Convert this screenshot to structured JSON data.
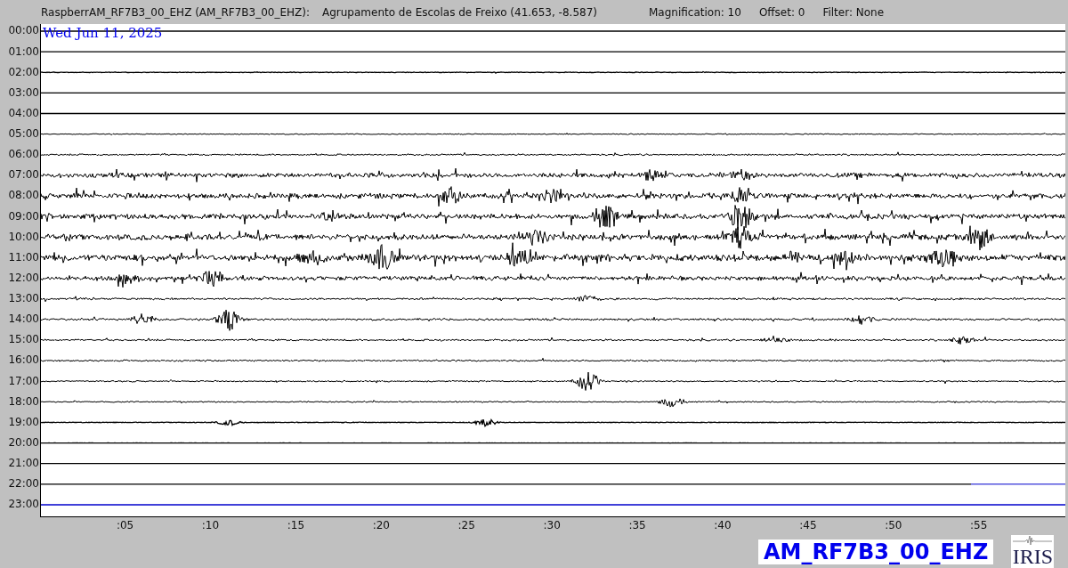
{
  "header": {
    "station": "RaspberrAM_RF7B3_00_EHZ (AM_RF7B3_00_EHZ):",
    "location": "Agrupamento de Escolas de Freixo (41.653, -8.587)",
    "magnification": "Magnification: 10",
    "offset": "Offset: 0",
    "filter": "Filter: None"
  },
  "plot": {
    "date": "Wed Jun 11, 2025",
    "hours": [
      "00:00",
      "01:00",
      "02:00",
      "03:00",
      "04:00",
      "05:00",
      "06:00",
      "07:00",
      "08:00",
      "09:00",
      "10:00",
      "11:00",
      "12:00",
      "13:00",
      "14:00",
      "15:00",
      "16:00",
      "17:00",
      "18:00",
      "19:00",
      "20:00",
      "21:00",
      "22:00",
      "23:00"
    ],
    "minute_labels": [
      ":05",
      ":10",
      ":15",
      ":20",
      ":25",
      ":30",
      ":35",
      ":40",
      ":45",
      ":50",
      ":55"
    ]
  },
  "channel_label": "AM_RF7B3_00_EHZ",
  "logo_text": "IRIS"
}
